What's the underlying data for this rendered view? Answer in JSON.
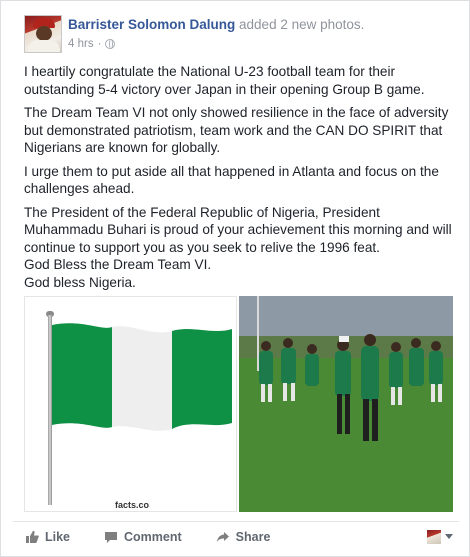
{
  "post": {
    "author": "Barrister Solomon Dalung",
    "action": " added 2 new photos.",
    "time": "4 hrs",
    "separator": "·",
    "paragraphs": [
      "I heartily congratulate the National U-23 football team for their outstanding 5-4 victory over Japan in their opening Group B game.",
      "The Dream Team VI not only showed resilience in the face of adversity but demonstrated patriotism, team work and the CAN DO SPIRIT that Nigerians are known for globally.",
      "I urge them to put aside all that happened in Atlanta and focus on the challenges ahead.",
      "The President of the Federal Republic of Nigeria, President Muhammadu Buhari is proud of your achievement this morning and will continue to support you as you seek to relive the 1996 feat.",
      "God Bless the Dream Team VI.",
      "God bless Nigeria."
    ]
  },
  "photos": {
    "flag_watermark": "facts.co"
  },
  "actions": {
    "like": "Like",
    "comment": "Comment",
    "share": "Share"
  },
  "colors": {
    "link": "#365899",
    "flag_green": "#0f9145",
    "grass": "#4d8a36"
  },
  "icons": [
    "globe-icon",
    "like-icon",
    "comment-icon",
    "share-icon",
    "chevron-down-icon"
  ]
}
